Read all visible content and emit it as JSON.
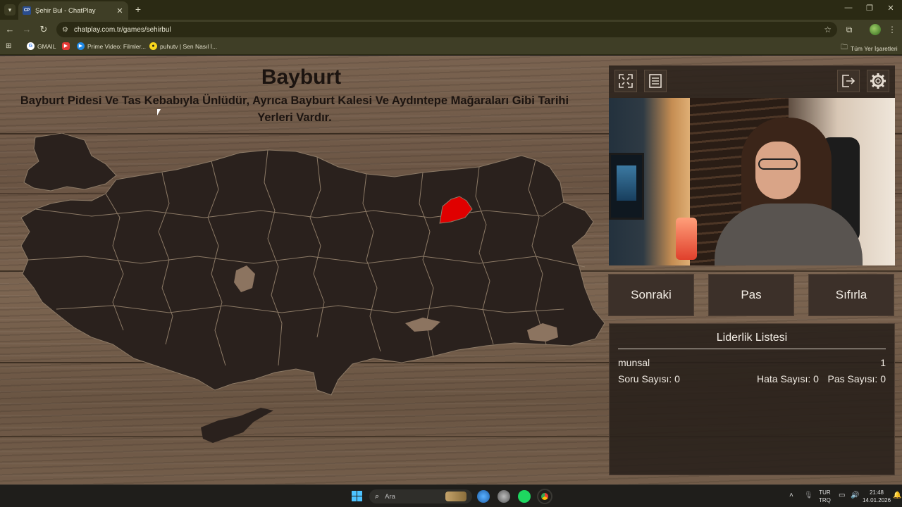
{
  "browser": {
    "tab_title": "Şehir Bul - ChatPlay",
    "tab_favicon": "CP",
    "url": "chatplay.com.tr/games/sehirbul",
    "bookmarks": [
      {
        "label": "GMAIL",
        "icon": "google-icon"
      },
      {
        "label": "",
        "icon": "youtube-icon"
      },
      {
        "label": "Prime Video: Filmler...",
        "icon": "prime-video-icon"
      },
      {
        "label": "puhutv | Sen Nasıl İ...",
        "icon": "puhutv-icon"
      }
    ],
    "all_bookmarks_label": "Tüm Yer İşaretleri"
  },
  "game": {
    "city_name": "Bayburt",
    "city_description": "Bayburt Pidesi Ve Tas Kebabıyla Ünlüdür, Ayrıca Bayburt Kalesi Ve Aydıntepe Mağaraları Gibi Tarihi Yerleri Vardır.",
    "highlight_color": "#e00000",
    "map_color": "#2a211d",
    "map_border_color": "#8c7a66"
  },
  "panel": {
    "icons": [
      "fullscreen-icon",
      "list-icon",
      "exit-icon",
      "settings-icon"
    ],
    "buttons": {
      "next": "Sonraki",
      "pass": "Pas",
      "reset": "Sıfırla"
    },
    "leaderboard": {
      "title": "Liderlik Listesi",
      "player_name": "munsal",
      "player_score": "1",
      "question_count": "Soru Sayısı: 0",
      "error_count": "Hata Sayısı: 0",
      "pass_count": "Pas Sayısı: 0"
    }
  },
  "taskbar": {
    "search_placeholder": "Ara",
    "language_line1": "TUR",
    "language_line2": "TRQ",
    "time": "21:48",
    "date": "14.01.2026"
  }
}
